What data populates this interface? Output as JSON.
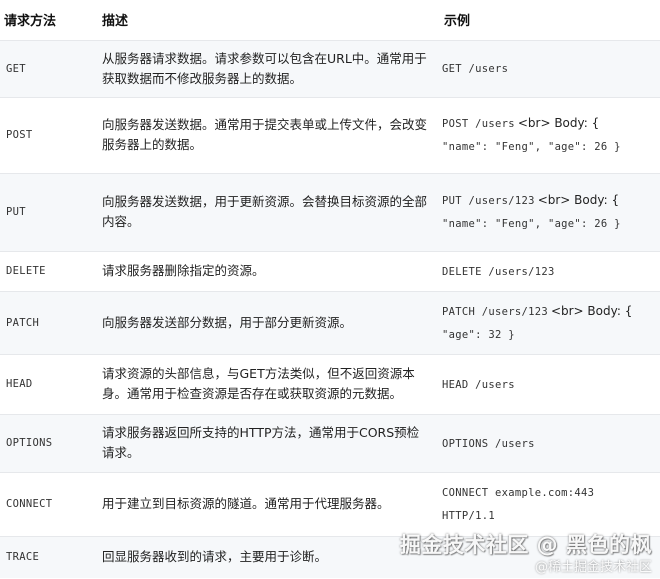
{
  "table": {
    "headers": {
      "method": "请求方法",
      "description": "描述",
      "example": "示例"
    },
    "rows": [
      {
        "method": "GET",
        "description": "从服务器请求数据。请求参数可以包含在URL中。通常用于获取数据而不修改服务器上的数据。",
        "example_code_1": "GET /users",
        "example_br": "",
        "example_code_2": ""
      },
      {
        "method": "POST",
        "description": "向服务器发送数据。通常用于提交表单或上传文件，会改变服务器上的数据。",
        "example_code_1": "POST /users",
        "example_br": "<br> Body: {",
        "example_code_2": "\"name\": \"Feng\", \"age\": 26 }"
      },
      {
        "method": "PUT",
        "description": "向服务器发送数据，用于更新资源。会替换目标资源的全部内容。",
        "example_code_1": "PUT /users/123",
        "example_br": "<br> Body: {",
        "example_code_2": "\"name\": \"Feng\", \"age\": 26 }"
      },
      {
        "method": "DELETE",
        "description": "请求服务器删除指定的资源。",
        "example_code_1": "DELETE /users/123",
        "example_br": "",
        "example_code_2": ""
      },
      {
        "method": "PATCH",
        "description": "向服务器发送部分数据，用于部分更新资源。",
        "example_code_1": "PATCH /users/123",
        "example_br": "<br> Body: {",
        "example_code_2": "\"age\": 32 }"
      },
      {
        "method": "HEAD",
        "description": "请求资源的头部信息，与GET方法类似，但不返回资源本身。通常用于检查资源是否存在或获取资源的元数据。",
        "example_code_1": "HEAD /users",
        "example_br": "",
        "example_code_2": ""
      },
      {
        "method": "OPTIONS",
        "description": "请求服务器返回所支持的HTTP方法，通常用于CORS预检请求。",
        "example_code_1": "OPTIONS /users",
        "example_br": "",
        "example_code_2": ""
      },
      {
        "method": "CONNECT",
        "description": "用于建立到目标资源的隧道。通常用于代理服务器。",
        "example_code_1": "CONNECT example.com:443",
        "example_br": "",
        "example_code_2": "HTTP/1.1"
      },
      {
        "method": "TRACE",
        "description": "回显服务器收到的请求，主要用于诊断。",
        "example_code_1": "",
        "example_br": "",
        "example_code_2": ""
      }
    ]
  },
  "watermark": {
    "main": "掘金技术社区 @ 黑色的枫",
    "sub": "@稀土掘金技术社区"
  }
}
